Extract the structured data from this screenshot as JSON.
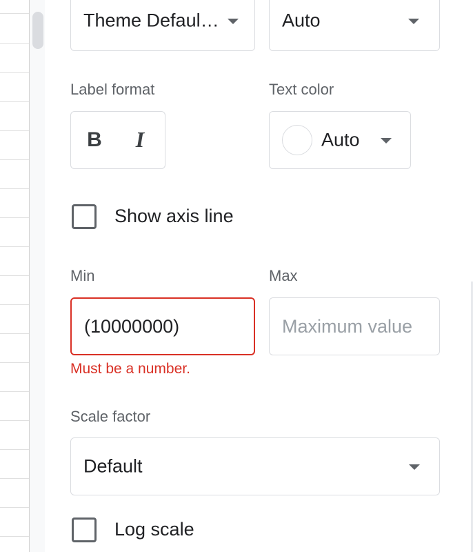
{
  "font_select": {
    "value": "Theme Defaul…"
  },
  "size_select": {
    "value": "Auto"
  },
  "label_format": {
    "label": "Label format",
    "bold": "B",
    "italic": "I"
  },
  "text_color": {
    "label": "Text color",
    "value": "Auto",
    "swatch_color": "#ffffff"
  },
  "show_axis_line": {
    "label": "Show axis line",
    "checked": false
  },
  "min": {
    "label": "Min",
    "value": "(10000000)",
    "placeholder": "",
    "error": "Must be a number."
  },
  "max": {
    "label": "Max",
    "value": "",
    "placeholder": "Maximum value"
  },
  "scale_factor": {
    "label": "Scale factor",
    "value": "Default"
  },
  "log_scale": {
    "label": "Log scale",
    "checked": false
  },
  "colors": {
    "error": "#d93025",
    "border": "#dadce0",
    "text": "#202124",
    "muted": "#5f6368"
  }
}
